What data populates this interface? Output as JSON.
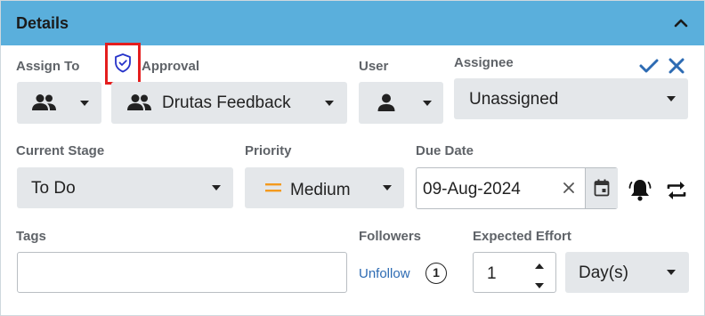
{
  "header": {
    "title": "Details"
  },
  "assign_to": {
    "label": "Assign To"
  },
  "approval": {
    "label": "Approval",
    "value": "Drutas Feedback"
  },
  "user": {
    "label": "User"
  },
  "assignee": {
    "label": "Assignee",
    "value": "Unassigned"
  },
  "current_stage": {
    "label": "Current Stage",
    "value": "To Do"
  },
  "priority": {
    "label": "Priority",
    "value": "Medium",
    "icon_color": "#f39a1e"
  },
  "due_date": {
    "label": "Due Date",
    "value": "09-Aug-2024"
  },
  "tags": {
    "label": "Tags",
    "value": ""
  },
  "followers": {
    "label": "Followers",
    "action": "Unfollow",
    "count": "1"
  },
  "expected_effort": {
    "label": "Expected Effort",
    "value": "1",
    "unit": "Day(s)"
  },
  "colors": {
    "header_bg": "#5aafdc",
    "accent": "#2d6bb3",
    "highlight": "#e41e1e",
    "field_bg": "#e4e7ea"
  },
  "icons": [
    "chevron-up-icon",
    "shield-check-icon",
    "group-icon",
    "person-icon",
    "check-icon",
    "close-icon",
    "calendar-icon",
    "bell-icon",
    "repeat-icon",
    "clear-icon",
    "spinner-up-icon",
    "spinner-down-icon"
  ]
}
